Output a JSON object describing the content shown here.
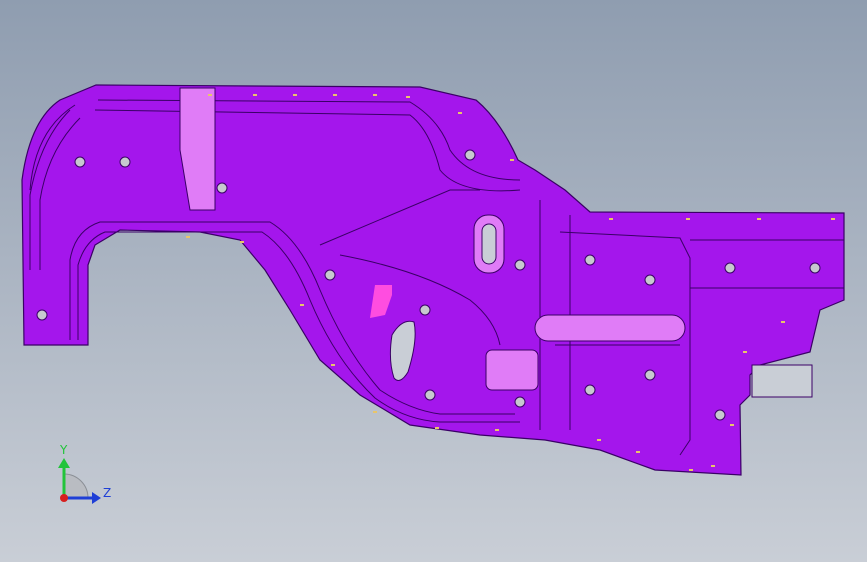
{
  "viewport": {
    "background_top": "#8f9db0",
    "background_bottom": "#c9ced6"
  },
  "part": {
    "fill_color": "#a416ec",
    "edge_color": "#3a0066",
    "highlight_color": "#e07cf7",
    "shadow_color": "#6a00a8",
    "marker_color": "#e8c56a"
  },
  "triad": {
    "y_label": "Y",
    "z_label": "Z",
    "y_color": "#22c43a",
    "z_color": "#1f3fd6",
    "x_color": "#d61f1f"
  }
}
